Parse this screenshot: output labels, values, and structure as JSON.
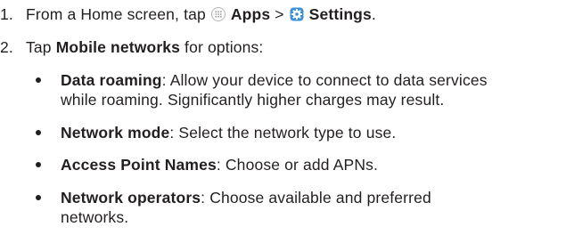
{
  "steps": [
    {
      "number": "1.",
      "prefix": "From a Home screen, tap ",
      "apps_label": "Apps",
      "separator": " > ",
      "settings_label": "Settings",
      "suffix": "."
    },
    {
      "number": "2.",
      "prefix": "Tap ",
      "bold": "Mobile networks",
      "suffix": " for options:"
    }
  ],
  "options": [
    {
      "term": "Data roaming",
      "description": ": Allow your device to connect to data services",
      "continuation": "while roaming. Significantly higher charges may result."
    },
    {
      "term": "Network mode",
      "description": ": Select the network type to use."
    },
    {
      "term": "Access Point Names",
      "description": ": Choose or add APNs."
    },
    {
      "term": "Network operators",
      "description": ": Choose available and preferred",
      "continuation": "networks."
    }
  ],
  "icons": {
    "apps": "apps-grid-icon",
    "settings": "settings-gear-icon",
    "settings_color": "#3a8fd9",
    "apps_color": "#b5b5b5"
  }
}
